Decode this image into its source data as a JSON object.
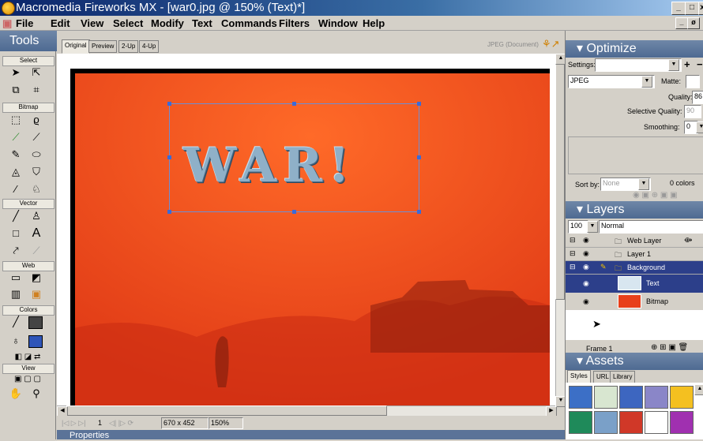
{
  "window": {
    "title": "Macromedia Fireworks MX - [war0.jpg @  150% (Text)*]"
  },
  "menu": [
    "File",
    "Edit",
    "View",
    "Select",
    "Modify",
    "Text",
    "Commands",
    "Filters",
    "Window",
    "Help"
  ],
  "tools": {
    "title": "Tools",
    "sections": [
      "Select",
      "Bitmap",
      "Vector",
      "Web",
      "Colors",
      "View"
    ]
  },
  "document": {
    "tabs": [
      "Original",
      "Preview",
      "2-Up",
      "4-Up"
    ],
    "format_label": "JPEG (Document)",
    "canvas_text": "WAR!"
  },
  "statusbar": {
    "size": "670 x 452",
    "zoom": "150%",
    "frame": "1"
  },
  "properties_panel": {
    "title": "Properties"
  },
  "optimize": {
    "title": "Optimize",
    "settings_label": "Settings:",
    "settings_value": "",
    "format": "JPEG",
    "matte_label": "Matte:",
    "quality_label": "Quality:",
    "quality_value": "86",
    "selective_quality_label": "Selective Quality:",
    "selective_quality_value": "90",
    "smoothing_label": "Smoothing:",
    "smoothing_value": "0",
    "sort_by_label": "Sort by:",
    "sort_by_value": "None",
    "colors_count": "0 colors"
  },
  "layers": {
    "title": "Layers",
    "opacity": "100",
    "blend_mode": "Normal",
    "items": [
      {
        "name": "Web Layer"
      },
      {
        "name": "Layer 1"
      },
      {
        "name": "Background"
      },
      {
        "name": "Text"
      },
      {
        "name": "Bitmap"
      }
    ],
    "frame_label": "Frame 1"
  },
  "assets": {
    "title": "Assets",
    "tabs": [
      "Styles",
      "URL",
      "Library"
    ],
    "swatch_colors": [
      "#3c6fc6",
      "#d8e6d0",
      "#3d66c0",
      "#8a86c8",
      "#f4c020",
      "#1f8a5a",
      "#7aa0c8",
      "#d03828",
      "#ffffff",
      "#a030b0"
    ]
  }
}
